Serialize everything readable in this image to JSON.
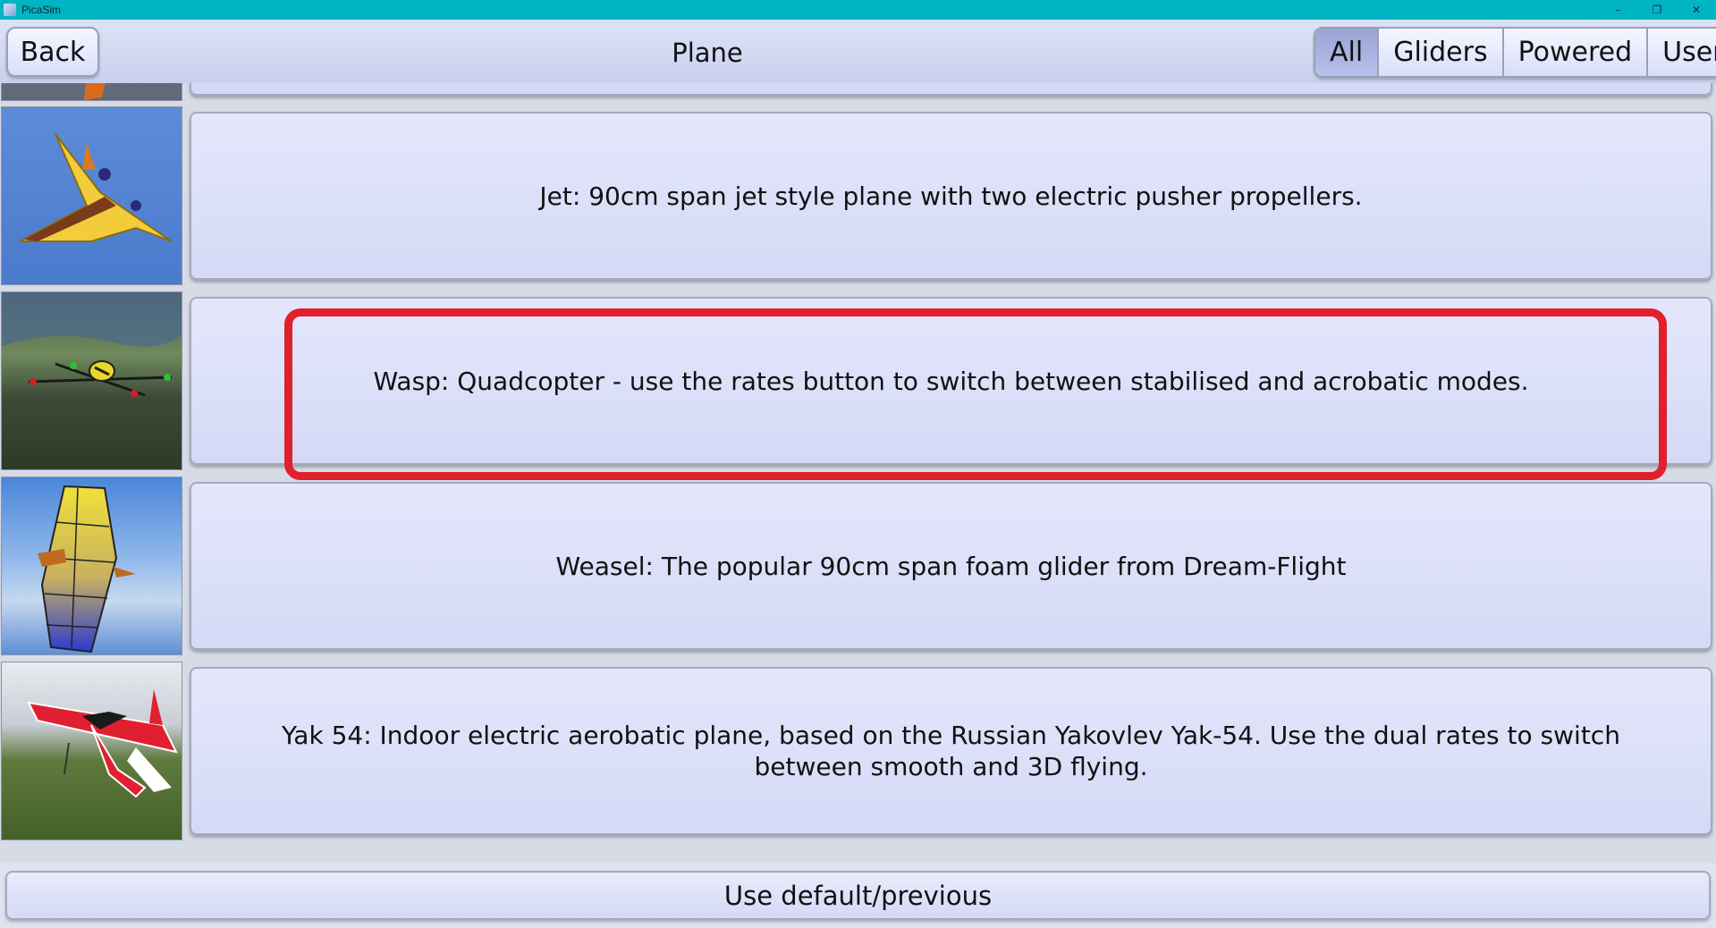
{
  "window": {
    "title": "PicaSim",
    "controls": {
      "minimize": "–",
      "maximize": "❐",
      "close": "✕"
    }
  },
  "header": {
    "back_label": "Back",
    "title": "Plane",
    "filters": [
      {
        "label": "All",
        "active": true
      },
      {
        "label": "Gliders",
        "active": false
      },
      {
        "label": "Powered",
        "active": false
      },
      {
        "label": "User",
        "active": false
      }
    ]
  },
  "planes": [
    {
      "description": ""
    },
    {
      "description": "Jet: 90cm span jet style plane with two electric pusher propellers."
    },
    {
      "description": "Wasp: Quadcopter - use the rates button to switch between stabilised and acrobatic modes."
    },
    {
      "description": "Weasel: The popular 90cm span foam glider from Dream-Flight"
    },
    {
      "description": "Yak 54: Indoor electric aerobatic plane, based on the Russian Yakovlev Yak-54. Use the dual rates to switch between smooth and 3D flying."
    }
  ],
  "footer": {
    "default_label": "Use default/previous"
  },
  "colors": {
    "titlebar": "#00b4c4",
    "highlight": "#e0202a",
    "active_filter": "#9aa3d4"
  }
}
